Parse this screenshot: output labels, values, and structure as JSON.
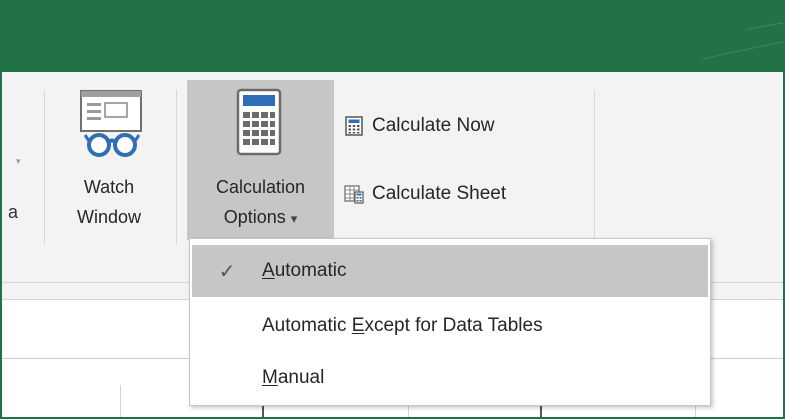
{
  "ribbon": {
    "partial_label": "a",
    "watch_window": {
      "line1": "Watch",
      "line2": "Window"
    },
    "calculation_options": {
      "line1": "Calculation",
      "line2": "Options",
      "dropdown_arrow": "▾"
    },
    "calculate_now": "Calculate Now",
    "calculate_sheet": "Calculate Sheet"
  },
  "menu": {
    "items": [
      {
        "pre": "",
        "key": "A",
        "post": "utomatic",
        "checked": true,
        "check": "✓"
      },
      {
        "pre": "Automatic ",
        "key": "E",
        "post": "xcept for Data Tables",
        "checked": false
      },
      {
        "pre": "",
        "key": "M",
        "post": "anual",
        "checked": false
      }
    ]
  },
  "colors": {
    "title_bar": "#217346",
    "ribbon": "#f3f3f3",
    "highlight": "#c6c6c6",
    "icon_blue": "#2f6fb5"
  },
  "icons": [
    "watch-window-icon",
    "calculator-icon",
    "calculate-now-icon",
    "calculate-sheet-icon",
    "checkmark-icon"
  ]
}
